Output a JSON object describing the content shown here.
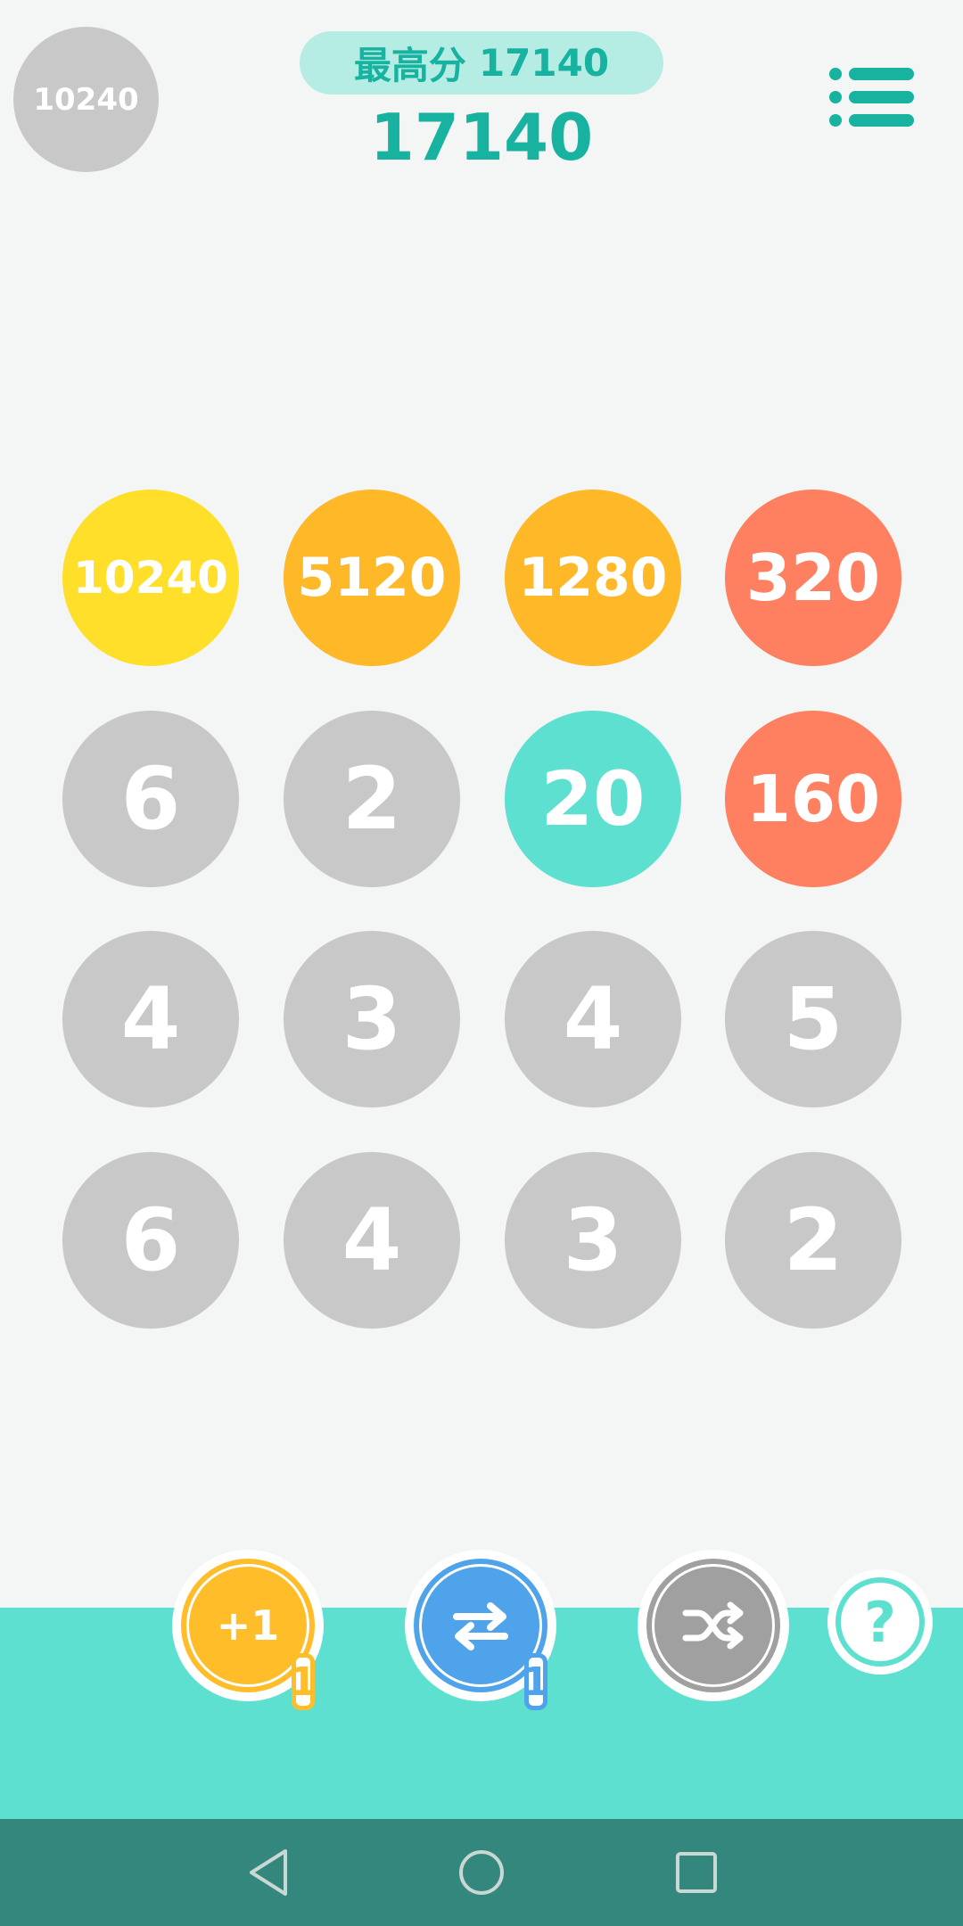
{
  "header": {
    "target_tile": "10240",
    "best_score_label": "最高分",
    "best_score_value": "17140",
    "current_score": "17140"
  },
  "board": {
    "rows": [
      [
        "10240",
        "5120",
        "1280",
        "320"
      ],
      [
        "6",
        "2",
        "20",
        "160"
      ],
      [
        "4",
        "3",
        "4",
        "5"
      ],
      [
        "6",
        "4",
        "3",
        "2"
      ]
    ]
  },
  "colors": {
    "gray": "#c8c8c8",
    "yellow": "#ffdf2a",
    "orange": "#ffb828",
    "coral": "#ff8060",
    "teal": "#5de0d0",
    "accent": "#17b3a0",
    "nav_bar": "#34877c",
    "background": "#f3f6f4",
    "tool_add": "#ffbd2a",
    "tool_swap": "#4fa3ea",
    "tool_shuffle": "#a0a0a0"
  },
  "tools": {
    "add_label": "+1",
    "add_count": "1",
    "swap_count": "1",
    "help_label": "?"
  }
}
